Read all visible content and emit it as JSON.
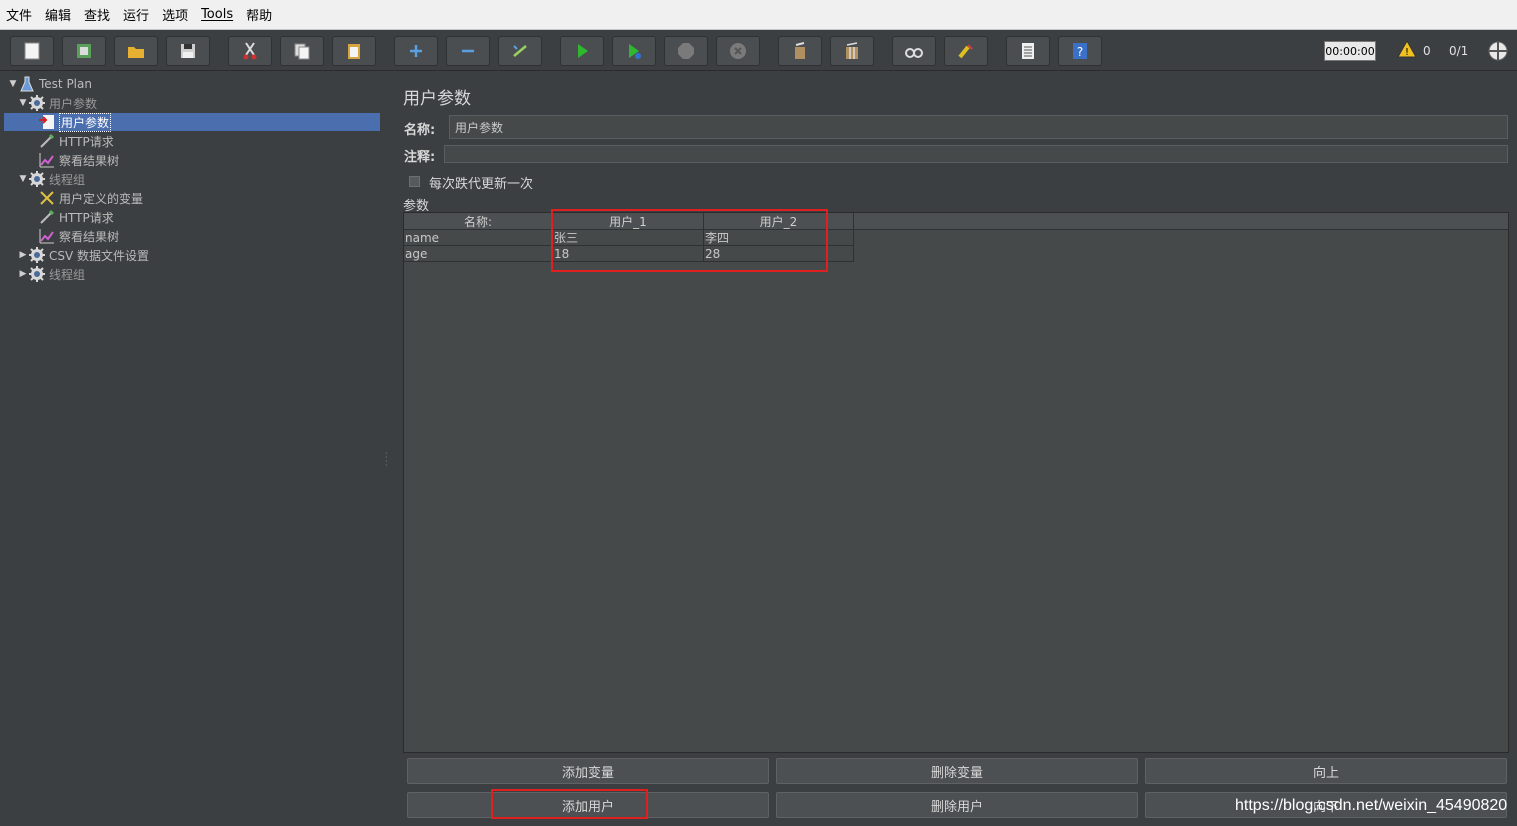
{
  "menu": [
    "文件",
    "编辑",
    "查找",
    "运行",
    "选项",
    "Tools",
    "帮助"
  ],
  "toolbar": {
    "icons": [
      "new-icon",
      "templates-icon",
      "open-icon",
      "save-icon",
      "cut-icon",
      "copy-icon",
      "paste-icon",
      "expand-icon",
      "collapse-icon",
      "toggle-icon",
      "start-icon",
      "start-no-pause-icon",
      "stop-icon",
      "shutdown-icon",
      "clear-icon",
      "clear-all-icon",
      "search-icon",
      "reset-search-icon",
      "function-helper-icon",
      "help-icon"
    ],
    "timer": "00:00:00",
    "warning_count": "0",
    "thread_count": "0/1"
  },
  "tree": [
    {
      "label": "Test Plan",
      "depth": 0,
      "toggle": "▼",
      "icon": "flask-icon",
      "selected": false,
      "dim": false
    },
    {
      "label": "用户参数",
      "depth": 1,
      "toggle": "▼",
      "icon": "gear-icon",
      "selected": false,
      "dim": true
    },
    {
      "label": "用户参数",
      "depth": 2,
      "toggle": "",
      "icon": "params-icon",
      "selected": true,
      "dim": false
    },
    {
      "label": "HTTP请求",
      "depth": 2,
      "toggle": "",
      "icon": "pipette-icon",
      "selected": false,
      "dim": false
    },
    {
      "label": "察看结果树",
      "depth": 2,
      "toggle": "",
      "icon": "graph-icon",
      "selected": false,
      "dim": false
    },
    {
      "label": "线程组",
      "depth": 1,
      "toggle": "▼",
      "icon": "gear-icon",
      "selected": false,
      "dim": true
    },
    {
      "label": "用户定义的变量",
      "depth": 2,
      "toggle": "",
      "icon": "wrench-icon",
      "selected": false,
      "dim": false
    },
    {
      "label": "HTTP请求",
      "depth": 2,
      "toggle": "",
      "icon": "pipette-icon",
      "selected": false,
      "dim": false
    },
    {
      "label": "察看结果树",
      "depth": 2,
      "toggle": "",
      "icon": "graph-icon",
      "selected": false,
      "dim": false
    },
    {
      "label": "CSV 数据文件设置",
      "depth": 1,
      "toggle": "▶",
      "icon": "gear-icon",
      "selected": false,
      "dim": false
    },
    {
      "label": "线程组",
      "depth": 1,
      "toggle": "▶",
      "icon": "gear-icon",
      "selected": false,
      "dim": true
    }
  ],
  "panel": {
    "title": "用户参数",
    "name_label": "名称:",
    "name_value": "用户参数",
    "comment_label": "注释:",
    "comment_value": "",
    "checkbox_label": "每次跌代更新一次",
    "params_label": "参数"
  },
  "table": {
    "headers": [
      "名称:",
      "用户_1",
      "用户_2"
    ],
    "rows": [
      [
        "name",
        "张三",
        "李四"
      ],
      [
        "age",
        "18",
        "28"
      ]
    ]
  },
  "buttons": {
    "add_var": "添加变量",
    "del_var": "删除变量",
    "up": "向上",
    "add_user": "添加用户",
    "del_user": "删除用户",
    "down": "向下"
  },
  "watermark": "https://blog.csdn.net/weixin_45490820",
  "colors": {
    "highlight": "#e02020",
    "selection": "#4b6eaf",
    "background": "#3c3f41"
  }
}
